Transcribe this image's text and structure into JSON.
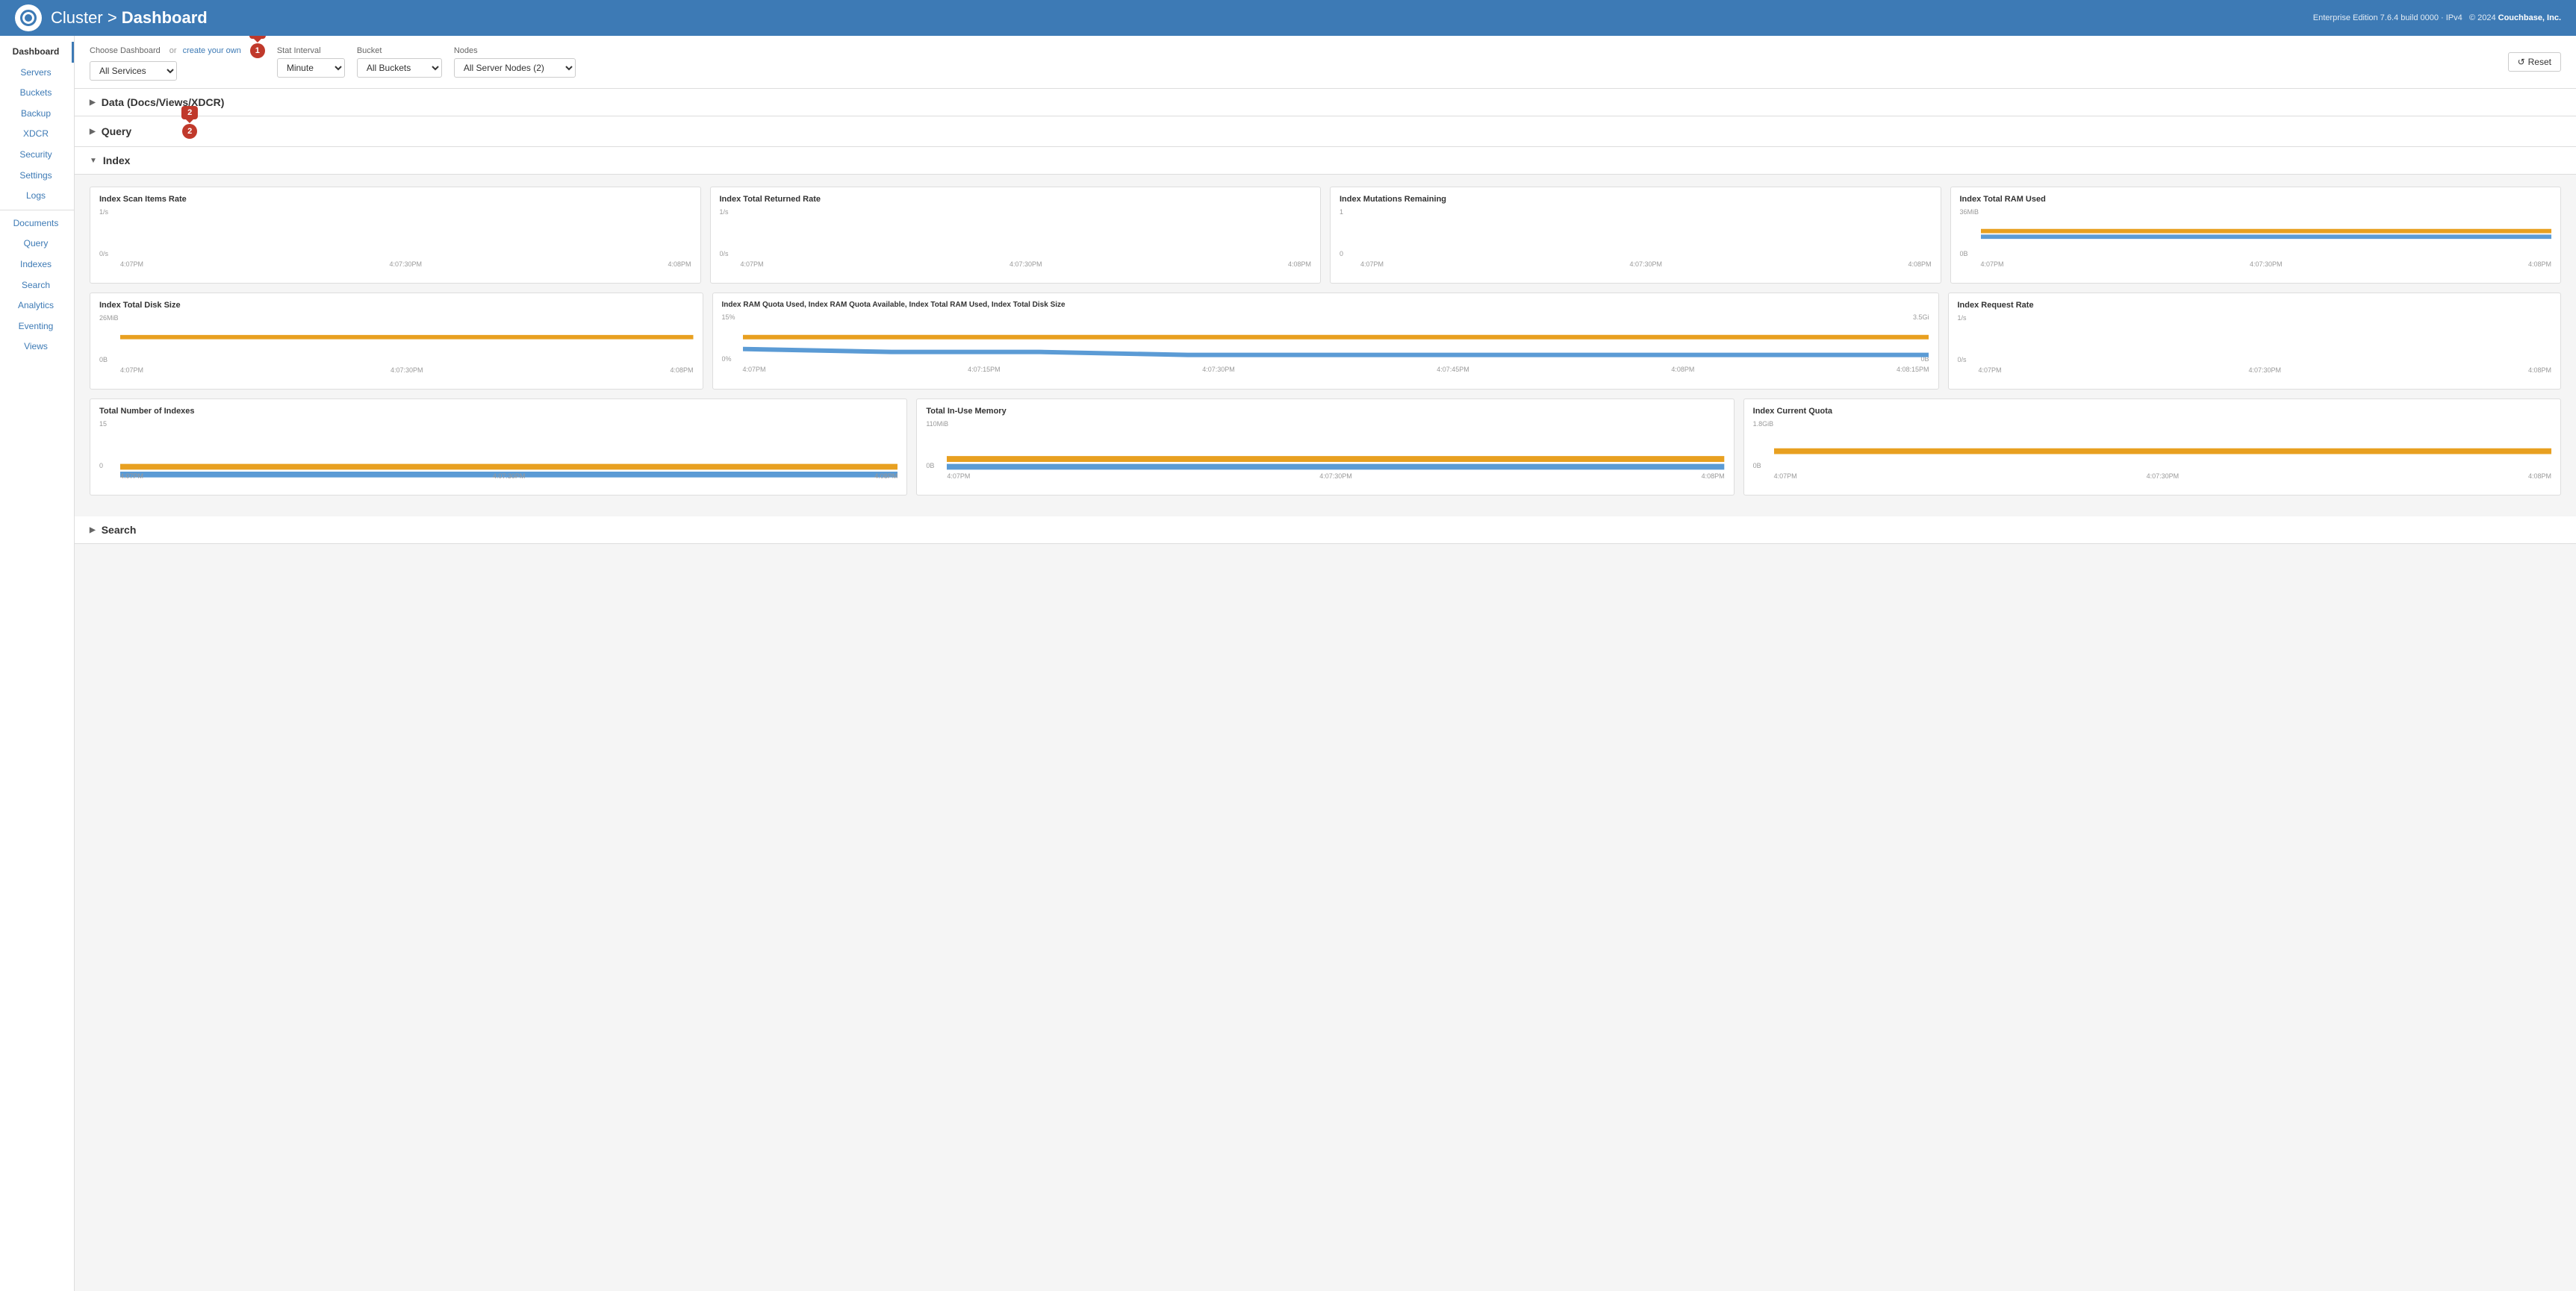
{
  "header": {
    "title": "Cluster",
    "separator": ">",
    "subtitle": "Dashboard",
    "edition": "Enterprise Edition 7.6.4 build 0000",
    "protocol": "IPv4",
    "copyright": "© 2024",
    "company": "Couchbase, Inc."
  },
  "sidebar": {
    "items": [
      {
        "id": "dashboard",
        "label": "Dashboard",
        "active": true
      },
      {
        "id": "servers",
        "label": "Servers",
        "active": false
      },
      {
        "id": "buckets",
        "label": "Buckets",
        "active": false
      },
      {
        "id": "backup",
        "label": "Backup",
        "active": false
      },
      {
        "id": "xdcr",
        "label": "XDCR",
        "active": false
      },
      {
        "id": "security",
        "label": "Security",
        "active": false
      },
      {
        "id": "settings",
        "label": "Settings",
        "active": false
      },
      {
        "id": "logs",
        "label": "Logs",
        "active": false
      }
    ],
    "items2": [
      {
        "id": "documents",
        "label": "Documents",
        "active": false
      },
      {
        "id": "query",
        "label": "Query",
        "active": false
      },
      {
        "id": "indexes",
        "label": "Indexes",
        "active": false
      },
      {
        "id": "search",
        "label": "Search",
        "active": false
      },
      {
        "id": "analytics",
        "label": "Analytics",
        "active": false
      },
      {
        "id": "eventing",
        "label": "Eventing",
        "active": false
      },
      {
        "id": "views",
        "label": "Views",
        "active": false
      }
    ]
  },
  "toolbar": {
    "choose_dashboard_label": "Choose Dashboard",
    "or_label": "or",
    "create_link": "create your own",
    "dashboard_options": [
      "All Services"
    ],
    "dashboard_selected": "All Services",
    "stat_interval_label": "Stat Interval",
    "stat_options": [
      "Minute"
    ],
    "stat_selected": "Minute",
    "bucket_label": "Bucket",
    "bucket_options": [
      "All Buckets"
    ],
    "bucket_selected": "All Buckets",
    "nodes_label": "Nodes",
    "nodes_options": [
      "All Server Nodes (2)"
    ],
    "nodes_selected": "All Server Nodes (2)",
    "reset_label": "Reset"
  },
  "sections": {
    "data_docs": {
      "label": "Data (Docs/Views/XDCR)",
      "collapsed": true
    },
    "query": {
      "label": "Query",
      "collapsed": true,
      "badge": "2"
    },
    "index": {
      "label": "Index",
      "collapsed": false
    },
    "search": {
      "label": "Search",
      "collapsed": true
    }
  },
  "index_charts": {
    "row1": [
      {
        "id": "index-scan-items-rate",
        "title": "Index Scan Items Rate",
        "y_top": "1/s",
        "y_bottom": "0/s",
        "x_labels": [
          "4:07PM",
          "4:07:30PM",
          "4:08PM"
        ],
        "line_color": "#e8a020"
      },
      {
        "id": "index-total-returned-rate",
        "title": "Index Total Returned Rate",
        "y_top": "1/s",
        "y_bottom": "0/s",
        "x_labels": [
          "4:07PM",
          "4:07:30PM",
          "4:08PM"
        ],
        "line_color": "#e8a020"
      },
      {
        "id": "index-mutations-remaining",
        "title": "Index Mutations Remaining",
        "y_top": "1",
        "y_bottom": "0",
        "x_labels": [
          "4:07PM",
          "4:07:30PM",
          "4:08PM"
        ],
        "line_color": "#e8a020"
      },
      {
        "id": "index-total-ram-used",
        "title": "Index Total RAM Used",
        "y_top": "36MiB",
        "y_bottom": "0B",
        "x_labels": [
          "4:07PM",
          "4:07:30PM",
          "4:08PM"
        ],
        "line_color": "#e8a020",
        "line2_color": "#5b9bd5"
      }
    ],
    "row2": [
      {
        "id": "index-total-disk-size",
        "title": "Index Total Disk Size",
        "y_top": "26MiB",
        "y_bottom": "0B",
        "x_labels": [
          "4:07PM",
          "4:07:30PM",
          "4:08PM"
        ],
        "line_color": "#e8a020",
        "line2_color": "#5b9bd5"
      },
      {
        "id": "index-ram-quota-multi",
        "title": "Index RAM Quota Used, Index RAM Quota Available, Index Total RAM Used, Index Total Disk Size",
        "y_top": "15%",
        "y_bottom": "0%",
        "y2_top": "3.5Gi",
        "y2_bottom": "0B",
        "x_labels": [
          "4:07PM",
          "4:07:15PM",
          "4:07:30PM",
          "4:07:45PM",
          "4:08PM",
          "4:08:15PM"
        ],
        "line_color": "#5b9bd5",
        "line2_color": "#e8a020"
      },
      {
        "id": "index-request-rate",
        "title": "Index Request Rate",
        "y_top": "1/s",
        "y_bottom": "0/s",
        "x_labels": [
          "4:07PM",
          "4:07:30PM",
          "4:08PM"
        ],
        "line_color": "#e8a020"
      }
    ],
    "row3": [
      {
        "id": "total-number-indexes",
        "title": "Total Number of Indexes",
        "y_top": "15",
        "y_bottom": "0",
        "x_labels": [
          "4:07PM",
          "4:07:30PM",
          "4:08PM"
        ],
        "line_color": "#e8a020",
        "line2_color": "#5b9bd5"
      },
      {
        "id": "total-in-use-memory",
        "title": "Total In-Use Memory",
        "y_top": "110MiB",
        "y_bottom": "0B",
        "x_labels": [
          "4:07PM",
          "4:07:30PM",
          "4:08PM"
        ],
        "line_color": "#e8a020",
        "line2_color": "#5b9bd5"
      },
      {
        "id": "index-current-quota",
        "title": "Index Current Quota",
        "y_top": "1.8GiB",
        "y_bottom": "0B",
        "x_labels": [
          "4:07PM",
          "4:07:30PM",
          "4:08PM"
        ],
        "line_color": "#e8a020"
      }
    ]
  }
}
